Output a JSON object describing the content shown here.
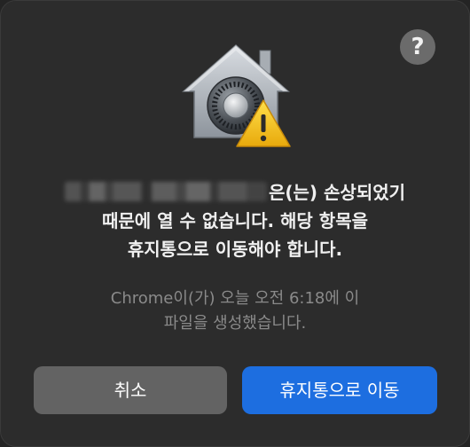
{
  "dialog": {
    "help_label": "?",
    "message_suffix": "은(는) 손상되었기",
    "message_line2": "때문에 열 수 없습니다. 해당 항목을",
    "message_line3": "휴지통으로 이동해야 합니다.",
    "detail_line1": "Chrome이(가) 오늘 오전 6:18에 이",
    "detail_line2": "파일을 생성했습니다.",
    "cancel_label": "취소",
    "trash_label": "휴지통으로 이동"
  },
  "icons": {
    "main": "gatekeeper-house-vault-icon",
    "warning": "warning-triangle-icon",
    "help": "question-mark-icon"
  },
  "colors": {
    "background": "#2c2c2c",
    "primary_button": "#1d6ee0",
    "secondary_button": "#636363",
    "warning": "#f5c518"
  }
}
